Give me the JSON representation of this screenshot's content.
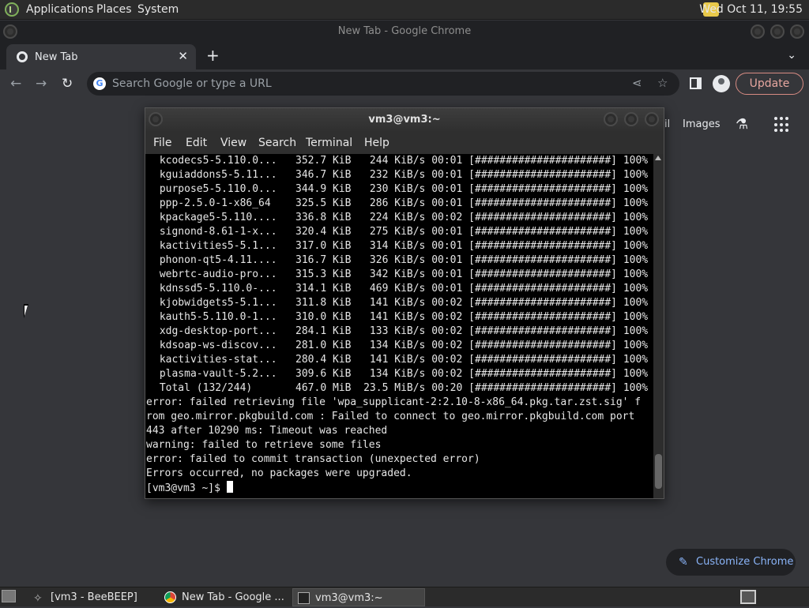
{
  "top_panel": {
    "menus": [
      "Applications",
      "Places",
      "System"
    ],
    "clock": "Wed Oct 11, 19:55"
  },
  "chrome": {
    "window_title": "New Tab - Google Chrome",
    "tab_label": "New Tab",
    "omnibox_placeholder": "Search Google or type a URL",
    "update_label": "Update",
    "ntp_link_partial": "il",
    "ntp_images": "Images",
    "customize_label": "Customize Chrome"
  },
  "terminal": {
    "title": "vm3@vm3:~",
    "menus": [
      "File",
      "Edit",
      "View",
      "Search",
      "Terminal",
      "Help"
    ],
    "download_rows": [
      " kcodecs5-5.110.0...   352.7 KiB   244 KiB/s 00:01 [######################] 100%",
      " kguiaddons5-5.11...   346.7 KiB   232 KiB/s 00:01 [######################] 100%",
      " purpose5-5.110.0...   344.9 KiB   230 KiB/s 00:01 [######################] 100%",
      " ppp-2.5.0-1-x86_64    325.5 KiB   286 KiB/s 00:01 [######################] 100%",
      " kpackage5-5.110....   336.8 KiB   224 KiB/s 00:02 [######################] 100%",
      " signond-8.61-1-x...   320.4 KiB   275 KiB/s 00:01 [######################] 100%",
      " kactivities5-5.1...   317.0 KiB   314 KiB/s 00:01 [######################] 100%",
      " phonon-qt5-4.11....   316.7 KiB   326 KiB/s 00:01 [######################] 100%",
      " webrtc-audio-pro...   315.3 KiB   342 KiB/s 00:01 [######################] 100%",
      " kdnssd5-5.110.0-...   314.1 KiB   469 KiB/s 00:01 [######################] 100%",
      " kjobwidgets5-5.1...   311.8 KiB   141 KiB/s 00:02 [######################] 100%",
      " kauth5-5.110.0-1...   310.0 KiB   141 KiB/s 00:02 [######################] 100%",
      " xdg-desktop-port...   284.1 KiB   133 KiB/s 00:02 [######################] 100%",
      " kdsoap-ws-discov...   281.0 KiB   134 KiB/s 00:02 [######################] 100%",
      " kactivities-stat...   280.4 KiB   141 KiB/s 00:02 [######################] 100%",
      " plasma-vault-5.2...   309.6 KiB   134 KiB/s 00:02 [######################] 100%",
      " Total (132/244)       467.0 MiB  23.5 MiB/s 00:20 [######################] 100%"
    ],
    "messages": [
      "error: failed retrieving file 'wpa_supplicant-2:2.10-8-x86_64.pkg.tar.zst.sig' f",
      "rom geo.mirror.pkgbuild.com : Failed to connect to geo.mirror.pkgbuild.com port",
      "443 after 10290 ms: Timeout was reached",
      "warning: failed to retrieve some files",
      "error: failed to commit transaction (unexpected error)",
      "Errors occurred, no packages were upgraded."
    ],
    "prompt": "[vm3@vm3 ~]$ "
  },
  "taskbar": {
    "tasks": [
      "[vm3 - BeeBEEP]",
      "New Tab - Google ...",
      "vm3@vm3:~"
    ]
  }
}
